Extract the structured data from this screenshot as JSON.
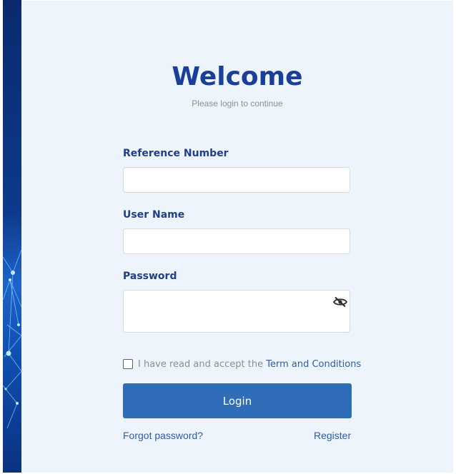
{
  "header": {
    "title": "Welcome",
    "subtitle": "Please login to continue"
  },
  "form": {
    "reference_label": "Reference Number",
    "reference_value": "",
    "username_label": "User Name",
    "username_value": "",
    "password_label": "Password",
    "password_value": "",
    "password_toggle_icon": "eye-slash-icon",
    "terms_prefix": "I have read and accept the",
    "terms_link": "Term and Conditions",
    "terms_checked": false,
    "login_label": "Login",
    "forgot_label": "Forgot password?",
    "register_label": "Register"
  },
  "colors": {
    "title": "#1a3f9a",
    "accent": "#2f6db8",
    "link": "#2f5ea8",
    "background": "#eef4fb",
    "side_panel": "#0d3a8c"
  }
}
